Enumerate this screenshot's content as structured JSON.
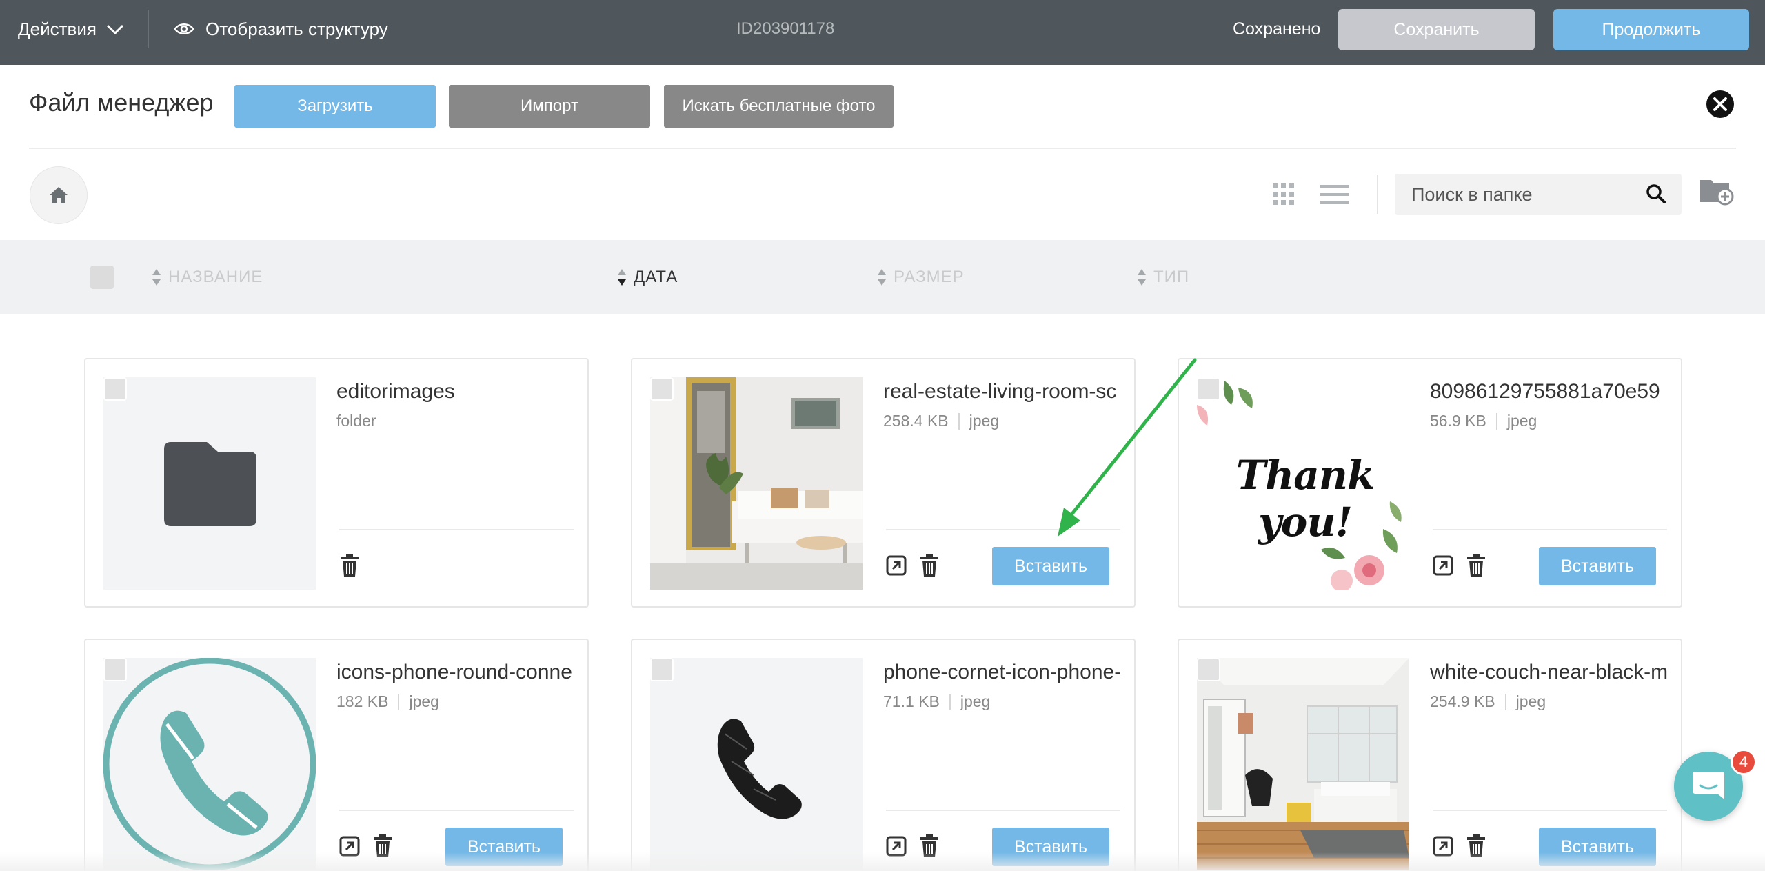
{
  "topbar": {
    "actions_label": "Действия",
    "structure_label": "Отобразить структуру",
    "site_id": "ID203901178",
    "status": "Сохранено",
    "save_label": "Сохранить",
    "continue_label": "Продолжить"
  },
  "file_manager": {
    "title": "Файл менеджер",
    "upload_label": "Загрузить",
    "import_label": "Импорт",
    "free_photos_label": "Искать бесплатные фото"
  },
  "toolbar": {
    "search_placeholder": "Поиск в папке"
  },
  "columns": {
    "name": "НАЗВАНИЕ",
    "date": "ДАТА",
    "size": "РАЗМЕР",
    "type": "ТИП"
  },
  "files": [
    {
      "name": "editorimages",
      "size": "",
      "type": "folder"
    },
    {
      "name": "real-estate-living-room-sc",
      "size": "258.4 KB",
      "type": "jpeg"
    },
    {
      "name": "80986129755881a70e59",
      "size": "56.9 KB",
      "type": "jpeg"
    },
    {
      "name": "icons-phone-round-conne",
      "size": "182 KB",
      "type": "jpeg"
    },
    {
      "name": "phone-cornet-icon-phone-",
      "size": "71.1 KB",
      "type": "jpeg"
    },
    {
      "name": "white-couch-near-black-m",
      "size": "254.9 KB",
      "type": "jpeg"
    }
  ],
  "thumb_text": {
    "thank_you": "Thank you!"
  },
  "insert_label": "Вставить",
  "chat": {
    "badge_count": "4"
  },
  "colors": {
    "topbar_bg": "#50575c",
    "accent": "#73b8e6",
    "gray_button": "#888888",
    "annotation_arrow": "#2fb34a"
  }
}
